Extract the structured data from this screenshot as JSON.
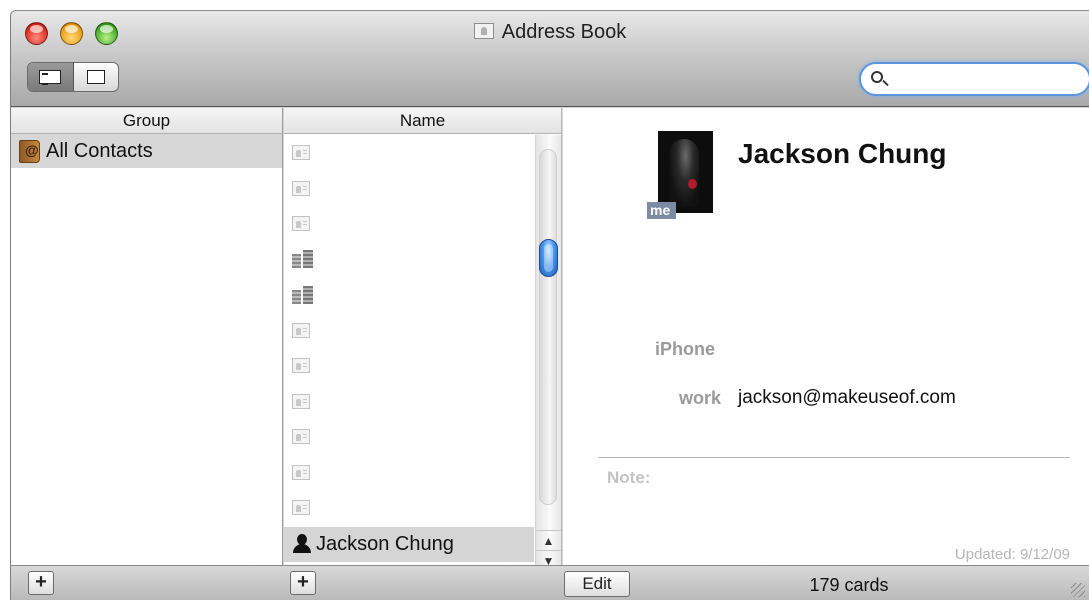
{
  "window": {
    "title": "Address Book"
  },
  "toolbar": {
    "view_buttons": [
      {
        "icon": "list-card-view-icon",
        "active": true
      },
      {
        "icon": "card-only-view-icon",
        "active": false
      }
    ],
    "search": {
      "value": "",
      "placeholder": ""
    }
  },
  "groups": {
    "header": "Group",
    "items": [
      {
        "label": "All Contacts",
        "icon": "address-book-icon",
        "selected": true
      }
    ]
  },
  "names": {
    "header": "Name",
    "rows": [
      {
        "icon": "contact-card-icon",
        "label": ""
      },
      {
        "icon": "contact-card-icon",
        "label": ""
      },
      {
        "icon": "contact-card-icon",
        "label": ""
      },
      {
        "icon": "company-building-icon",
        "label": ""
      },
      {
        "icon": "company-building-icon",
        "label": ""
      },
      {
        "icon": "contact-card-icon",
        "label": ""
      },
      {
        "icon": "contact-card-icon",
        "label": ""
      },
      {
        "icon": "contact-card-icon",
        "label": ""
      },
      {
        "icon": "contact-card-icon",
        "label": ""
      },
      {
        "icon": "contact-card-icon",
        "label": ""
      },
      {
        "icon": "contact-card-icon",
        "label": ""
      }
    ],
    "selected": {
      "icon": "person-silhouette-icon",
      "label": "Jackson Chung"
    }
  },
  "card": {
    "name": "Jackson Chung",
    "me_badge": "me",
    "phone_label": "iPhone",
    "email_label": "work",
    "email_value": "jackson@makeuseof.com",
    "note_label": "Note:",
    "updated": "Updated: 9/12/09"
  },
  "bottom": {
    "add_group_label": "+",
    "add_contact_label": "+",
    "edit_label": "Edit",
    "card_count": "179 cards"
  },
  "colors": {
    "selection_gray": "#d5d5d5",
    "search_focus": "#5d95da",
    "scroll_thumb": "#4a98ee",
    "me_badge": "#7c8aa3",
    "label_gray": "#9a9a9a"
  }
}
